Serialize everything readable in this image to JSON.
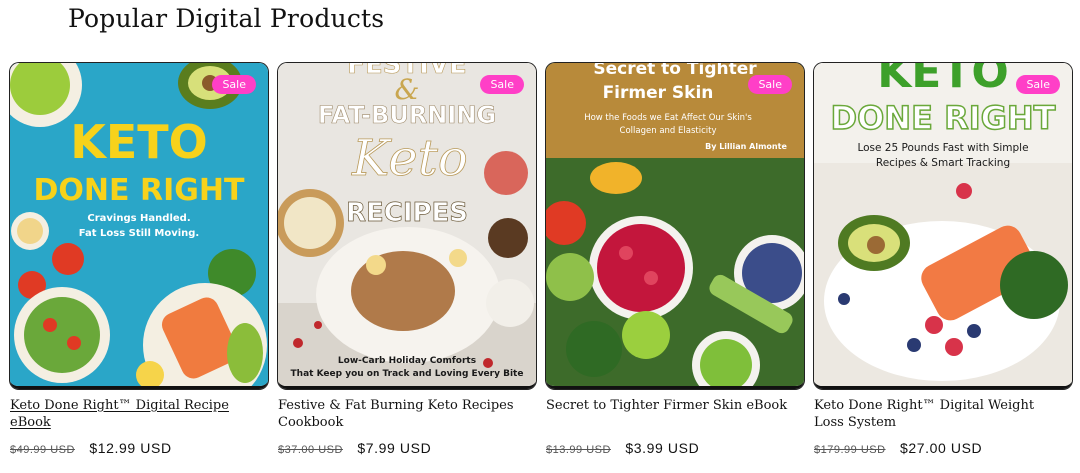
{
  "section": {
    "title": "Popular Digital Products"
  },
  "products": [
    {
      "badge": "Sale",
      "cover": {
        "headline_1": "KETO",
        "headline_2": "DONE RIGHT",
        "sub_1": "Cravings Handled.",
        "sub_2": "Fat Loss Still Moving."
      },
      "title": "Keto Done Right™ Digital Recipe eBook",
      "compare_price": "$49.99 USD",
      "price": "$12.99 USD"
    },
    {
      "badge": "Sale",
      "cover": {
        "headline_1": "FESTIVE",
        "headline_2": "&",
        "headline_3": "FAT-BURNING",
        "script": "Keto",
        "headline_4": "RECIPES",
        "sub_1": "Low-Carb Holiday Comforts",
        "sub_2": "That Keep you on Track and Loving Every Bite"
      },
      "title": "Festive & Fat Burning Keto Recipes Cookbook",
      "compare_price": "$37.00 USD",
      "price": "$7.99 USD"
    },
    {
      "badge": "Sale",
      "cover": {
        "headline_1": "Secret to Tighter",
        "headline_2": "Firmer Skin",
        "sub_1": "How the Foods we Eat Affect Our Skin's",
        "sub_2": "Collagen and Elasticity",
        "author": "By Lillian Almonte"
      },
      "title": "Secret to Tighter Firmer Skin eBook",
      "compare_price": "$13.99 USD",
      "price": "$3.99 USD"
    },
    {
      "badge": "Sale",
      "cover": {
        "headline_1": "KETO",
        "headline_2": "DONE RIGHT",
        "sub_1": "Lose 25 Pounds Fast with Simple",
        "sub_2": "Recipes & Smart Tracking"
      },
      "title": "Keto Done Right™ Digital Weight Loss System",
      "compare_price": "$179.99 USD",
      "price": "$27.00 USD"
    }
  ],
  "colors": {
    "badge": "#ff3fc7",
    "text": "#121212"
  }
}
